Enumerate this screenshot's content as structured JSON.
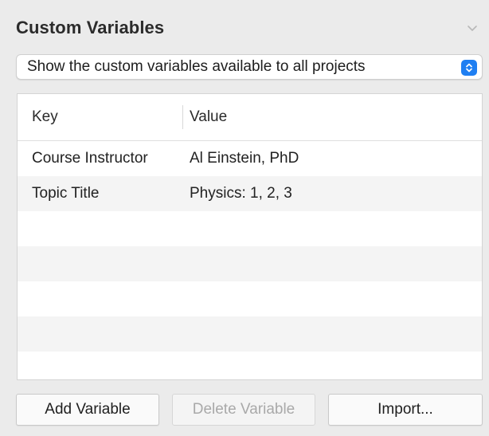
{
  "panel": {
    "title": "Custom Variables",
    "collapse_icon": "chevron-down-icon"
  },
  "scope_select": {
    "selected": "Show the custom variables available to all projects",
    "icon": "popup-stepper-icon",
    "accent": "#1f7ff2"
  },
  "table": {
    "columns": [
      "Key",
      "Value"
    ],
    "rows": [
      {
        "key": "Course Instructor",
        "value": "Al Einstein, PhD"
      },
      {
        "key": "Topic Title",
        "value": "Physics: 1, 2, 3"
      }
    ]
  },
  "buttons": {
    "add": "Add Variable",
    "delete": "Delete Variable",
    "import": "Import..."
  }
}
